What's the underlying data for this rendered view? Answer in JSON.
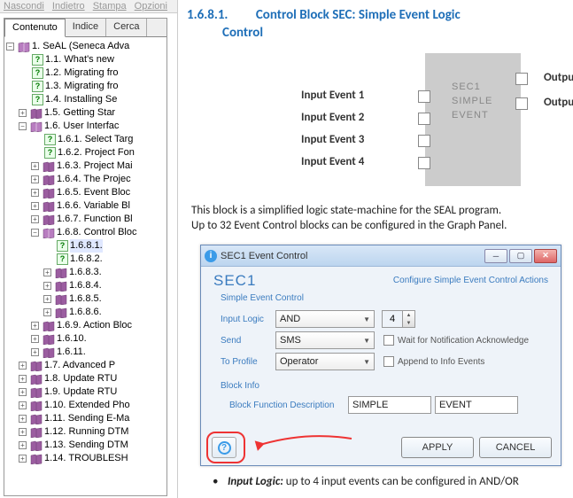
{
  "topbar": {
    "l1": "Nascondi",
    "l2": "Indietro",
    "l3": "Stampa",
    "l4": "Opzioni"
  },
  "tabs": {
    "contenuto": "Contenuto",
    "indice": "Indice",
    "cerca": "Cerca"
  },
  "tree": {
    "root": "1.      SeAL (Seneca Adva",
    "n11": "1.1.       What's new",
    "n12": "1.2.       Migrating fro",
    "n13": "1.3.       Migrating fro",
    "n14": "1.4.       Installing Se",
    "n15": "1.5.       Getting Star",
    "n16": "1.6.       User Interfac",
    "n161": "1.6.1. Select Targ",
    "n162": "1.6.2. Project Fon",
    "n163": "1.6.3. Project Mai",
    "n164": "1.6.4. The Projec",
    "n165": "1.6.5. Event Bloc",
    "n166": "1.6.6. Variable Bl",
    "n167": "1.6.7. Function Bl",
    "n168": "1.6.8. Control Bloc",
    "n1681": "1.6.8.1.",
    "n1682": "1.6.8.2.",
    "n1683": "1.6.8.3.",
    "n1684": "1.6.8.4.",
    "n1685": "1.6.8.5.",
    "n1686": "1.6.8.6.",
    "n169": "1.6.9. Action Bloc",
    "n1610": "1.6.10.",
    "n1611": "1.6.11.",
    "n17": "1.7.       Advanced P",
    "n18": "1.8.       Update RTU",
    "n19": "1.9.       Update RTU",
    "n110": "1.10.    Extended Pho",
    "n111": "1.11.    Sending E-Ma",
    "n112": "1.12.    Running DTM",
    "n113": "1.13.    Sending DTM",
    "n114": "1.14.    TROUBLESH"
  },
  "heading": {
    "num": "1.6.8.1.",
    "title1": "Control Block SEC: Simple Event Logic",
    "title2": "Control"
  },
  "inputs": {
    "i1": "Input Event 1",
    "i2": "Input Event 2",
    "i3": "Input Event 3",
    "i4": "Input Event 4"
  },
  "block": {
    "l1": "SEC1",
    "l2": "SIMPLE",
    "l3": "EVENT"
  },
  "outputs": {
    "o1": "Outpu",
    "o2": "Outpu"
  },
  "para": {
    "l1": "This block is a simplified logic state-machine for the SEAL program.",
    "l2": "Up to 32 Event Control blocks can be configured in the Graph Panel."
  },
  "dialog": {
    "title": "SEC1 Event Control",
    "h1": "SEC1",
    "link": "Configure Simple Event Control Actions",
    "sub": "Simple Event Control",
    "row_inputlogic": "Input Logic",
    "val_inputlogic": "AND",
    "val_spinner": "4",
    "row_send": "Send",
    "val_send": "SMS",
    "chk_wait": "Wait for Notification Acknowledge",
    "row_toprofile": "To Profile",
    "val_toprofile": "Operator",
    "chk_append": "Append to Info Events",
    "blockinfo": "Block Info",
    "bfd": "Block Function Description",
    "bfd_v1": "SIMPLE",
    "bfd_v2": "EVENT",
    "btn_apply": "APPLY",
    "btn_cancel": "CANCEL"
  },
  "bullet": {
    "label": "Input Logic:",
    "text": " up to 4 input events can be configured in AND/OR"
  }
}
